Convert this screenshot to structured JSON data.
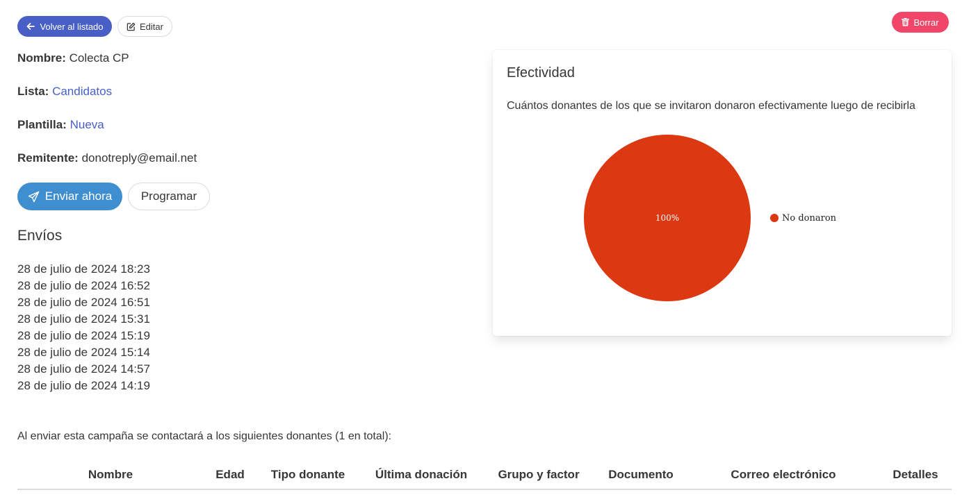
{
  "header": {
    "back_label": "Volver al listado",
    "edit_label": "Editar",
    "delete_label": "Borrar"
  },
  "campaign": {
    "nombre_label": "Nombre:",
    "nombre": "Colecta CP",
    "lista_label": "Lista:",
    "lista": "Candidatos",
    "plantilla_label": "Plantilla:",
    "plantilla": "Nueva",
    "remitente_label": "Remitente:",
    "remitente": "donotreply@email.net"
  },
  "actions": {
    "send_label": "Enviar ahora",
    "schedule_label": "Programar"
  },
  "envios": {
    "title": "Envíos",
    "items": [
      "28 de julio de 2024 18:23",
      "28 de julio de 2024 16:52",
      "28 de julio de 2024 16:51",
      "28 de julio de 2024 15:31",
      "28 de julio de 2024 15:19",
      "28 de julio de 2024 15:14",
      "28 de julio de 2024 14:57",
      "28 de julio de 2024 14:19"
    ]
  },
  "effectiveness": {
    "title": "Efectividad",
    "subtitle": "Cuántos donantes de los que se invitaron donaron efectivamente luego de recibirla"
  },
  "chart_data": {
    "type": "pie",
    "slices": [
      {
        "label": "No donaron",
        "value": 100,
        "display": "100%",
        "color": "#dc3912"
      }
    ],
    "legend_position": "right"
  },
  "contacts": {
    "note": "Al enviar esta campaña se contactará a los siguientes donantes (1 en total):",
    "columns": [
      "Nombre",
      "Edad",
      "Tipo donante",
      "Última donación",
      "Grupo y factor",
      "Documento",
      "Correo electrónico",
      "Detalles"
    ]
  },
  "icons": {
    "back": "arrow-left-icon",
    "edit": "edit-icon",
    "delete": "trash-icon",
    "send": "paper-plane-icon"
  },
  "colors": {
    "primary": "#485fc7",
    "info": "#3e8ed0",
    "danger": "#f14668",
    "pie": "#dc3912"
  }
}
